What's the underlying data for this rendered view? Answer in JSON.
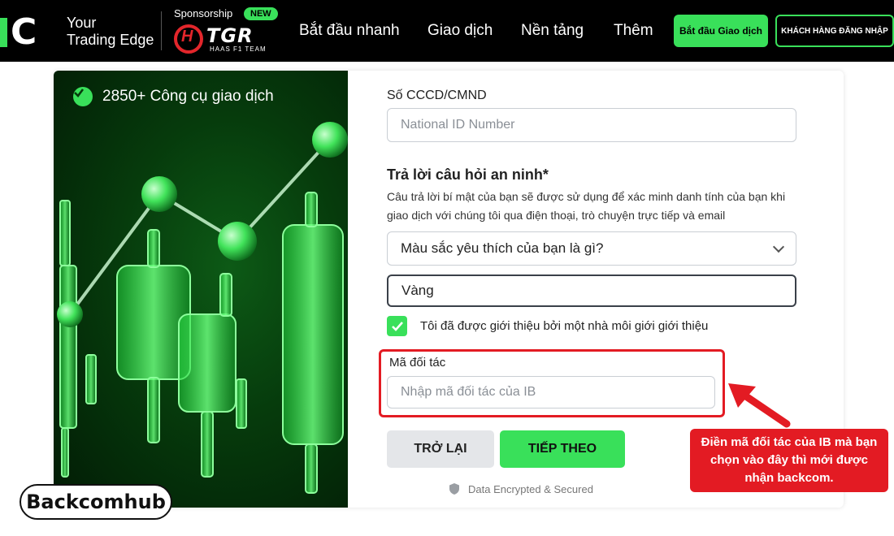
{
  "header": {
    "tagline_line1": "Your",
    "tagline_line2": "Trading Edge",
    "sponsor_label": "Sponsorship",
    "new_badge": "NEW",
    "sponsor_logo_text": "TGR",
    "sponsor_logo_sub": "HAAS F1 TEAM",
    "nav": [
      "Bắt đầu nhanh",
      "Giao dịch",
      "Nền tảng",
      "Thêm"
    ],
    "start_trading_button": "Bắt đầu Giao dịch",
    "client_login_button": "KHÁCH HÀNG ĐĂNG NHẬP",
    "accent_color": "#39e05a"
  },
  "hero": {
    "badge_text": "2850+ Công cụ giao dịch"
  },
  "form": {
    "id_label": "Số CCCD/CMND",
    "id_placeholder": "National ID Number",
    "security_title": "Trả lời câu hỏi an ninh*",
    "security_help": "Câu trả lời bí mật của bạn sẽ được sử dụng để xác minh danh tính của bạn khi giao dịch với chúng tôi qua điện thoại, trò chuyện trực tiếp và email",
    "security_question": "Màu sắc yêu thích của bạn là gì?",
    "security_answer": "Vàng",
    "referred_checkbox_label": "Tôi đã được giới thiệu bởi một nhà môi giới giới thiệu",
    "referred_checked": true,
    "partner_code_label": "Mã đối tác",
    "partner_code_placeholder": "Nhập mã đối tác của IB",
    "back_button": "TRỞ LẠI",
    "next_button": "TIẾP THEO",
    "secured_text": "Data Encrypted & Secured"
  },
  "annotation": {
    "callout_text": "Điền mã đối tác của IB mà bạn chọn vào đây thì mới được nhận backcom.",
    "highlight_color": "#e31b23"
  },
  "watermark": {
    "text": "Backcomhub"
  }
}
